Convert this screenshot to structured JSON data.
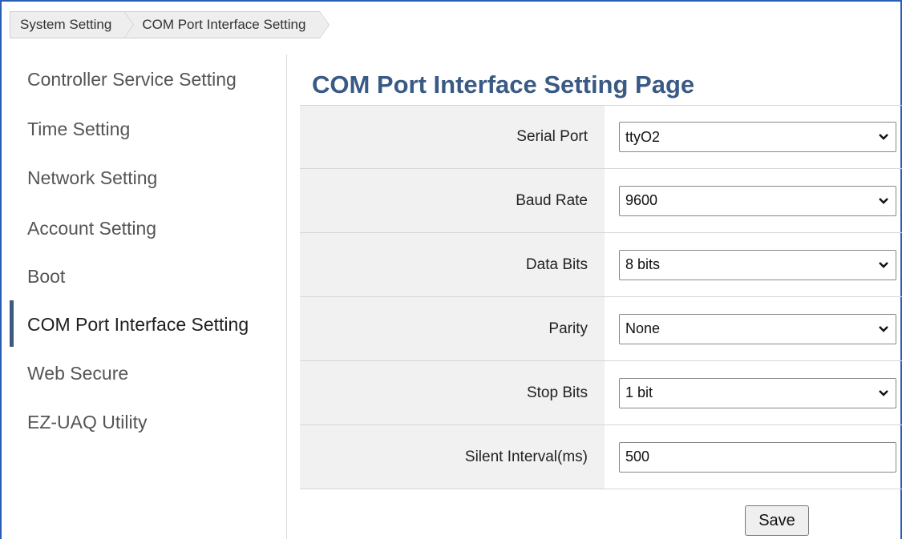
{
  "breadcrumb": {
    "items": [
      {
        "label": "System Setting"
      },
      {
        "label": "COM Port Interface Setting"
      }
    ]
  },
  "sidebar": {
    "items": [
      {
        "label": "Controller Service Setting",
        "active": false
      },
      {
        "label": "Time Setting",
        "active": false
      },
      {
        "label": "Network Setting",
        "active": false
      },
      {
        "label": "Account Setting",
        "active": false
      },
      {
        "label": "Boot",
        "active": false
      },
      {
        "label": "COM Port Interface Setting",
        "active": true
      },
      {
        "label": "Web Secure",
        "active": false
      },
      {
        "label": "EZ-UAQ Utility",
        "active": false
      }
    ]
  },
  "main": {
    "title": "COM Port Interface Setting Page",
    "fields": {
      "serial_port": {
        "label": "Serial Port",
        "value": "ttyO2"
      },
      "baud_rate": {
        "label": "Baud Rate",
        "value": "9600"
      },
      "data_bits": {
        "label": "Data Bits",
        "value": "8 bits"
      },
      "parity": {
        "label": "Parity",
        "value": "None"
      },
      "stop_bits": {
        "label": "Stop Bits",
        "value": "1 bit"
      },
      "silent_interval": {
        "label": "Silent Interval(ms)",
        "value": "500"
      }
    },
    "save_label": "Save"
  },
  "colors": {
    "frame_border": "#2a5fb5",
    "title": "#3a5a86",
    "active_indicator": "#3d5a80",
    "label_cell_bg": "#f1f1f1"
  },
  "icons": {
    "select_arrow": "chevron-down-icon"
  }
}
